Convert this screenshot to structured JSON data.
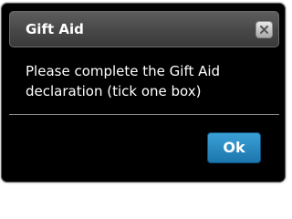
{
  "dialog": {
    "title": "Gift Aid",
    "close_icon": "close-icon",
    "message": "Please complete the Gift Aid declaration (tick one box)",
    "ok_label": "Ok"
  },
  "colors": {
    "dialog_background": "#000000",
    "titlebar": "#474747",
    "text": "#ffffff",
    "ok_button": "#1c76ad"
  }
}
